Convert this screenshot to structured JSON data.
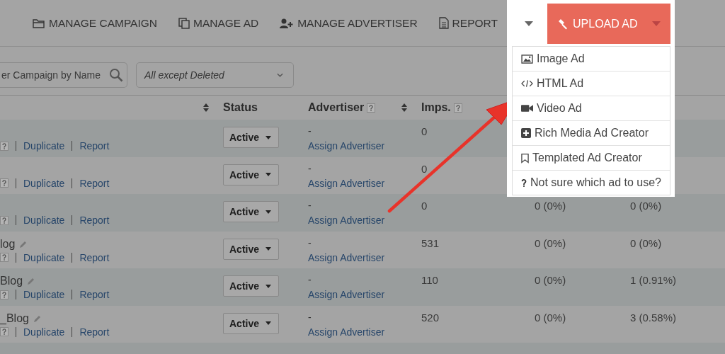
{
  "nav": {
    "items": [
      {
        "label": "MANAGE CAMPAIGN"
      },
      {
        "label": "MANAGE AD"
      },
      {
        "label": "MANAGE ADVERTISER"
      },
      {
        "label": "REPORT"
      }
    ],
    "upload": {
      "label": "UPLOAD AD",
      "expanded": true,
      "menu": [
        {
          "label": "Image Ad"
        },
        {
          "label": "HTML Ad"
        },
        {
          "label": "Video Ad"
        },
        {
          "label": "Rich Media Ad Creator"
        },
        {
          "label": "Templated Ad Creator"
        },
        {
          "label": "Not sure which ad to use?"
        }
      ]
    }
  },
  "filters": {
    "search": {
      "placeholder": "er Campaign by Name"
    },
    "status_select": {
      "value": "All except Deleted"
    }
  },
  "table": {
    "columns": [
      {
        "sortable": true
      },
      {
        "label": "Status"
      },
      {
        "label": "Advertiser",
        "sortable": true,
        "help": true
      },
      {
        "label": "Imps.",
        "help": true
      }
    ],
    "rows": [
      {
        "status": "Active",
        "advertiser": "-",
        "assign": "Assign Advertiser",
        "imps": "0",
        "actions": [
          "Duplicate",
          "Report"
        ]
      },
      {
        "status": "Active",
        "advertiser": "-",
        "assign": "Assign Advertiser",
        "imps": "0",
        "actions": [
          "Duplicate",
          "Report"
        ]
      },
      {
        "status": "Active",
        "advertiser": "-",
        "assign": "Assign Advertiser",
        "imps": "0",
        "column_5": "0 (0%)",
        "column_6": "0 (0%)",
        "actions": [
          "Duplicate",
          "Report"
        ]
      },
      {
        "name": "log",
        "status": "Active",
        "advertiser": "-",
        "assign": "Assign Advertiser",
        "imps": "531",
        "column_5": "0 (0%)",
        "column_6": "0 (0%)",
        "actions": [
          "Duplicate",
          "Report"
        ]
      },
      {
        "name": "Blog",
        "status": "Active",
        "advertiser": "-",
        "assign": "Assign Advertiser",
        "imps": "110",
        "column_5": "0 (0%)",
        "column_6": "1 (0.91%)",
        "actions": [
          "Duplicate",
          "Report"
        ]
      },
      {
        "name": "_Blog",
        "status": "Active",
        "advertiser": "-",
        "assign": "Assign Advertiser",
        "imps": "520",
        "column_5": "0 (0%)",
        "column_6": "3 (0.58%)",
        "actions": [
          "Duplicate",
          "Report"
        ]
      }
    ]
  }
}
